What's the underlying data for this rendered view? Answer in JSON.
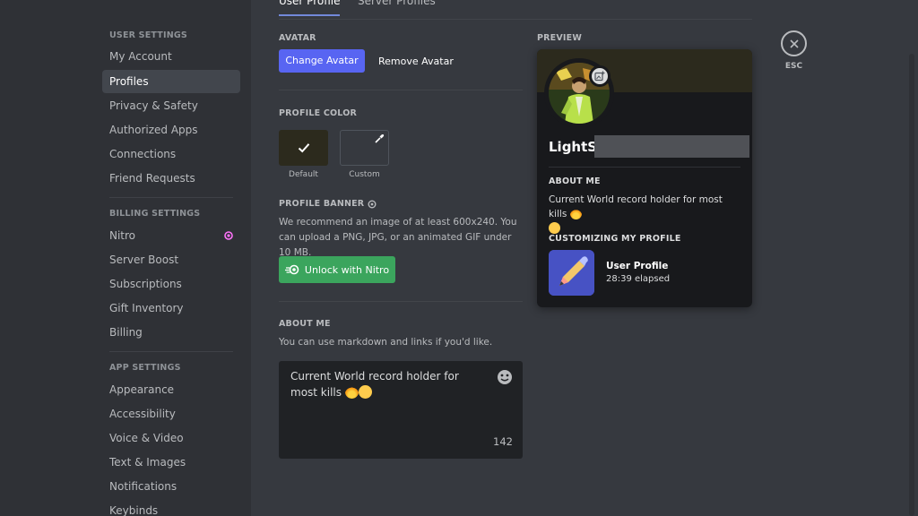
{
  "tabs": [
    {
      "label": "User Profile",
      "active": true
    },
    {
      "label": "Server Profiles",
      "active": false
    }
  ],
  "sidebar": {
    "user_settings_header": "USER SETTINGS",
    "billing_settings_header": "BILLING SETTINGS",
    "app_settings_header": "APP SETTINGS",
    "user_items": [
      "My Account",
      "Profiles",
      "Privacy & Safety",
      "Authorized Apps",
      "Connections",
      "Friend Requests"
    ],
    "billing_items": [
      "Nitro",
      "Server Boost",
      "Subscriptions",
      "Gift Inventory",
      "Billing"
    ],
    "app_items": [
      "Appearance",
      "Accessibility",
      "Voice & Video",
      "Text & Images",
      "Notifications",
      "Keybinds"
    ],
    "active_item": "Profiles"
  },
  "avatar": {
    "label": "AVATAR",
    "change_button": "Change Avatar",
    "remove_button": "Remove Avatar"
  },
  "profile_color": {
    "label": "PROFILE COLOR",
    "default_label": "Default",
    "custom_label": "Custom",
    "default_color": "#2c2a1d"
  },
  "profile_banner": {
    "label": "PROFILE BANNER",
    "description": "We recommend an image of at least 600x240. You can upload a PNG, JPG, or an animated GIF under 10 MB.",
    "unlock_button": "Unlock with Nitro"
  },
  "about_me": {
    "label": "ABOUT ME",
    "hint": "You can use markdown and links if you'd like.",
    "text": "Current World record holder for most kills",
    "char_count": "142"
  },
  "preview": {
    "label": "PREVIEW",
    "username": "LightS",
    "about_header": "ABOUT ME",
    "about_text": "Current World record holder for most kills",
    "customizing_header": "CUSTOMIZING MY PROFILE",
    "activity_title": "User Profile",
    "activity_time": "28:39 elapsed"
  },
  "esc_label": "ESC",
  "colors": {
    "accent": "#5865f2",
    "green": "#3ba55d",
    "nitro_pink": "#ff73fa"
  }
}
